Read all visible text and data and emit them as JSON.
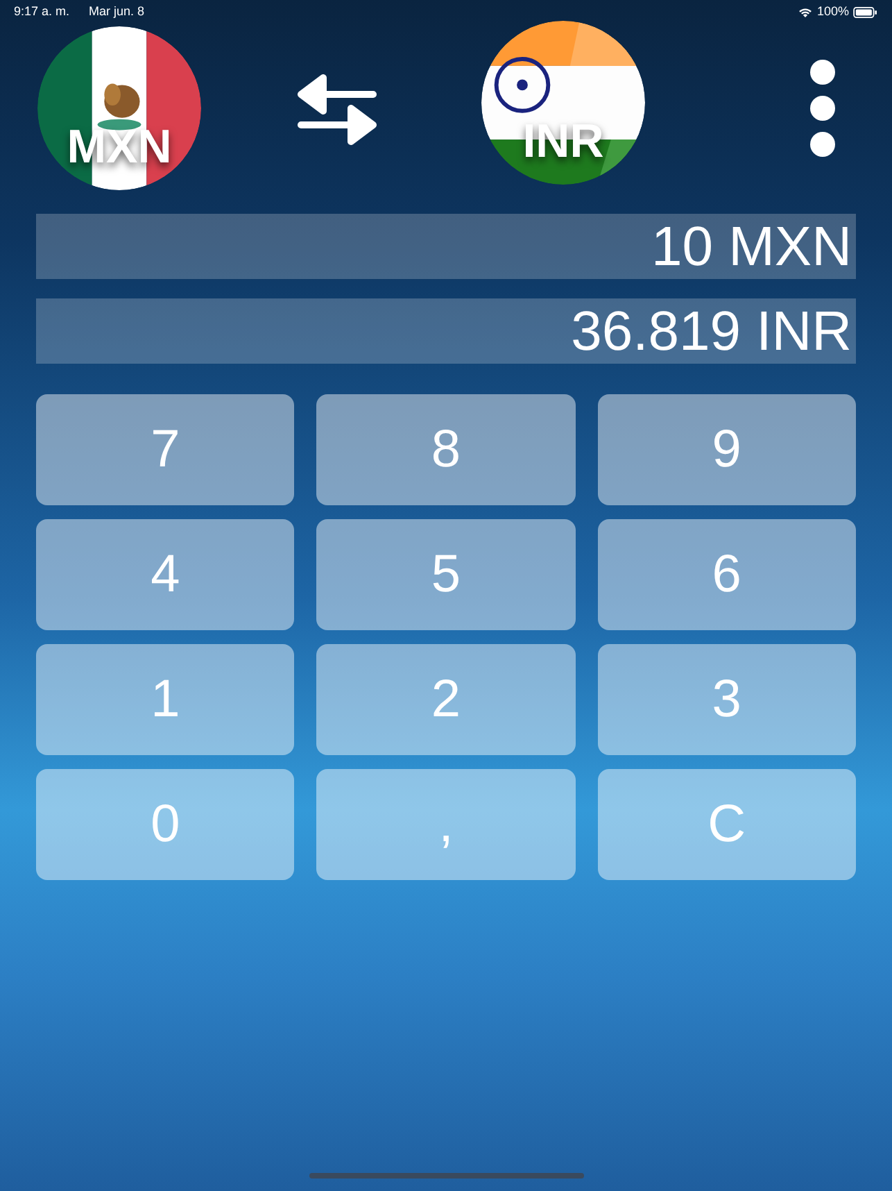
{
  "status_bar": {
    "time": "9:17 a. m.",
    "date": "Mar jun. 8",
    "battery": "100%"
  },
  "from_currency": {
    "code": "MXN"
  },
  "to_currency": {
    "code": "INR"
  },
  "amount": "10 MXN",
  "result": "36.819 INR",
  "keypad": [
    "7",
    "8",
    "9",
    "4",
    "5",
    "6",
    "1",
    "2",
    "3",
    "0",
    ",",
    "C"
  ]
}
